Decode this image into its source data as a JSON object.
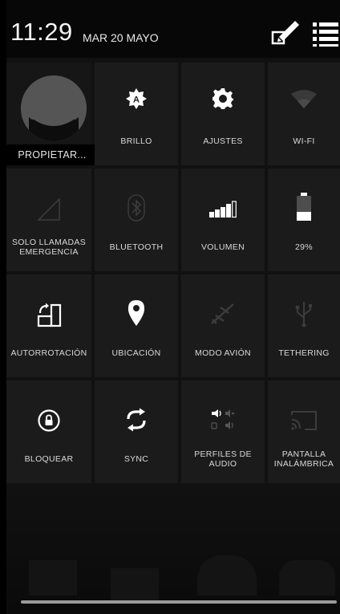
{
  "status": {
    "time": "11:29",
    "date": "MAR 20 MAYO"
  },
  "header_icons": {
    "edit": "edit-icon",
    "list": "list-settings-icon"
  },
  "user": {
    "label": "PROPIETAR..."
  },
  "tiles": [
    {
      "label": "BRILLO",
      "icon": "brightness-auto-icon"
    },
    {
      "label": "AJUSTES",
      "icon": "gear-icon"
    },
    {
      "label": "WI-FI",
      "icon": "wifi-icon"
    },
    {
      "label": "SOLO LLAMADAS EMERGENCIA",
      "icon": "signal-icon"
    },
    {
      "label": "BLUETOOTH",
      "icon": "bluetooth-icon"
    },
    {
      "label": "VOLUMEN",
      "icon": "volume-icon"
    },
    {
      "label": "29%",
      "icon": "battery-icon"
    },
    {
      "label": "AUTORROTACIÓN",
      "icon": "rotate-icon"
    },
    {
      "label": "UBICACIÓN",
      "icon": "location-icon"
    },
    {
      "label": "MODO AVIÓN",
      "icon": "airplane-icon"
    },
    {
      "label": "TETHERING",
      "icon": "usb-icon"
    },
    {
      "label": "BLOQUEAR",
      "icon": "lock-icon"
    },
    {
      "label": "SYNC",
      "icon": "sync-icon"
    },
    {
      "label": "PERFILES DE AUDIO",
      "icon": "audio-profiles-icon"
    },
    {
      "label": "PANTALLA INALÁMBRICA",
      "icon": "cast-icon"
    }
  ],
  "labels": {
    "emergency_line1": "SOLO LLAMADAS",
    "emergency_line2": "EMERGENCIA",
    "audio_line1": "PERFILES DE",
    "audio_line2": "AUDIO",
    "display_line1": "PANTALLA",
    "display_line2": "INALÁMBRICA"
  },
  "battery": {
    "level": 0.29
  }
}
